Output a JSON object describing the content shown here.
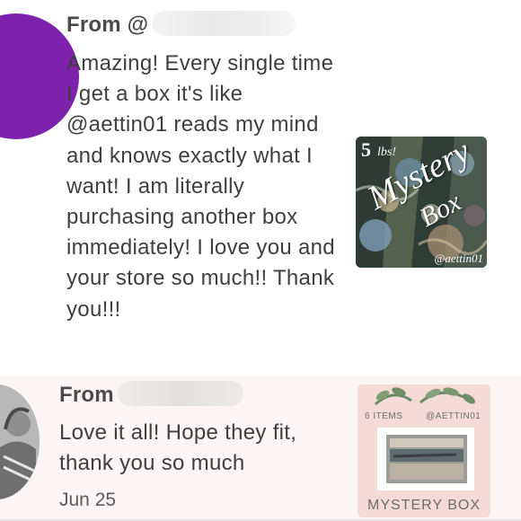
{
  "reviews": [
    {
      "from_label": "From @",
      "text": "Amazing! Every single time I get a box it's like @aettin01 reads my mind and knows exactly what I want! I am literally purchasing another box immediately! I love you and your store so much!! Thank you!!!",
      "date": "",
      "avatar_color": "#7e22ad",
      "thumbnail": {
        "count": "5",
        "unit": "lbs!",
        "title_line1": "Mystery",
        "title_line2": "Box",
        "handle": "@aettin01"
      }
    },
    {
      "from_label": "From",
      "text": "Love it all! Hope they fit, thank you so much",
      "date": "Jun 25",
      "thumbnail": {
        "items": "6 ITEMS",
        "handle": "@AETTIN01",
        "title": "MYSTERY BOX"
      }
    }
  ]
}
